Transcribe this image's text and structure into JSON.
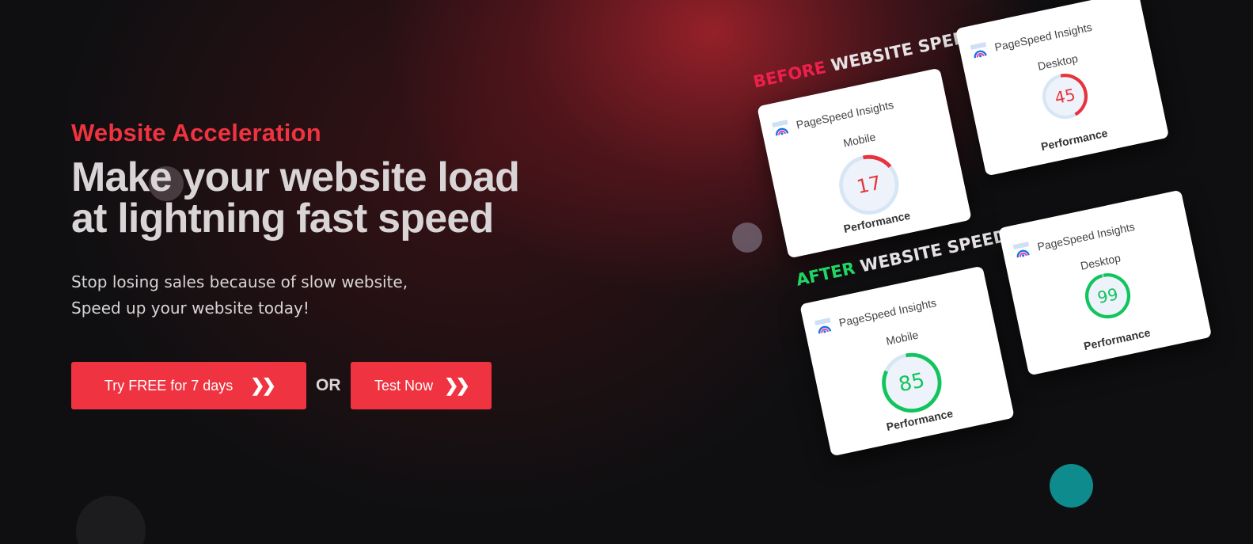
{
  "hero": {
    "kicker": "Website Acceleration",
    "headline_line1": "Make your website load",
    "headline_line2": "at lightning fast speed",
    "sub_line1": "Stop losing sales because of slow website,",
    "sub_line2": "Speed up your website today!"
  },
  "cta": {
    "try_label": "Try FREE for 7 days",
    "or_label": "OR",
    "test_label": "Test Now",
    "button_color": "#ef3340"
  },
  "before": {
    "prefix": "BEFORE",
    "suffix": "WEBSITE SPEEDY",
    "mobile": {
      "brand": "PageSpeed Insights",
      "device": "Mobile",
      "score": "17",
      "score_value": 17,
      "label": "Performance",
      "color": "#e8323c"
    },
    "desktop": {
      "brand": "PageSpeed Insights",
      "device": "Desktop",
      "score": "45",
      "score_value": 45,
      "label": "Performance",
      "color": "#e8323c"
    }
  },
  "after": {
    "prefix": "AFTER",
    "suffix": "WEBSITE SPEEDY",
    "mobile": {
      "brand": "PageSpeed Insights",
      "device": "Mobile",
      "score": "85",
      "score_value": 85,
      "label": "Performance",
      "color": "#10c55b"
    },
    "desktop": {
      "brand": "PageSpeed Insights",
      "device": "Desktop",
      "score": "99",
      "score_value": 99,
      "label": "Performance",
      "color": "#10c55b"
    }
  }
}
